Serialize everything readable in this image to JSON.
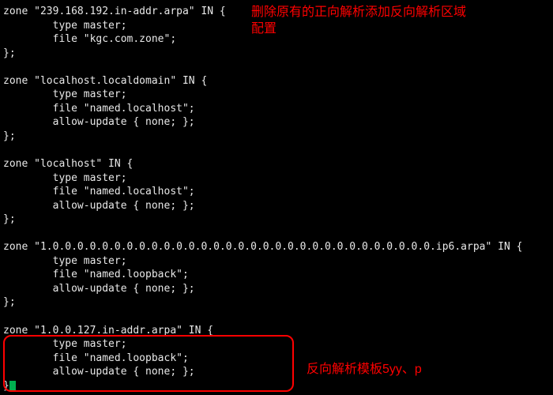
{
  "zones": {
    "z0_header": "zone \"239.168.192.in-addr.arpa\" IN {",
    "z0_type": "        type master;",
    "z0_file": "        file \"kgc.com.zone\";",
    "z0_close": "};",
    "z1_header": "zone \"localhost.localdomain\" IN {",
    "z1_type": "        type master;",
    "z1_file": "        file \"named.localhost\";",
    "z1_allow": "        allow-update { none; };",
    "z1_close": "};",
    "z2_header": "zone \"localhost\" IN {",
    "z2_type": "        type master;",
    "z2_file": "        file \"named.localhost\";",
    "z2_allow": "        allow-update { none; };",
    "z2_close": "};",
    "z3_header": "zone \"1.0.0.0.0.0.0.0.0.0.0.0.0.0.0.0.0.0.0.0.0.0.0.0.0.0.0.0.0.0.0.0.ip6.arpa\" IN {",
    "z3_type": "        type master;",
    "z3_file": "        file \"named.loopback\";",
    "z3_allow": "        allow-update { none; };",
    "z3_close": "};",
    "z4_header": "zone \"1.0.0.127.in-addr.arpa\" IN {",
    "z4_type": "        type master;",
    "z4_file": "        file \"named.loopback\";",
    "z4_allow": "        allow-update { none; };",
    "z4_close": "}"
  },
  "annotations": {
    "top": "删除原有的正向解析添加反向解析区域配置",
    "bottom": "反向解析模板5yy、p"
  }
}
